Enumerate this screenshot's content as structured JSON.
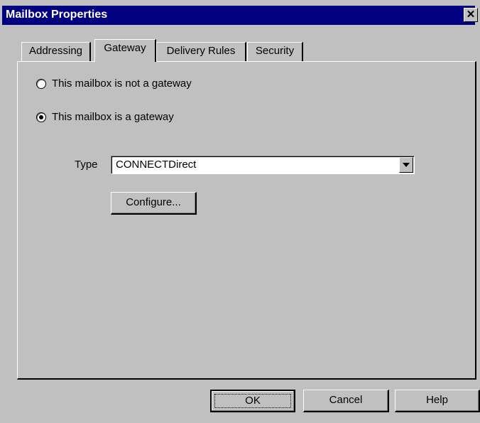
{
  "window": {
    "title": "Mailbox Properties",
    "close_glyph": "✕"
  },
  "tabs": [
    {
      "label": "Addressing",
      "active": false
    },
    {
      "label": "Gateway",
      "active": true
    },
    {
      "label": "Delivery Rules",
      "active": false
    },
    {
      "label": "Security",
      "active": false
    }
  ],
  "gateway": {
    "radio_not_gateway": {
      "label": "This mailbox is not a gateway",
      "selected": false
    },
    "radio_is_gateway": {
      "label": "This mailbox is a gateway",
      "selected": true
    },
    "type_label": "Type",
    "type_value": "CONNECTDirect",
    "configure_label": "Configure..."
  },
  "footer": {
    "ok_label": "OK",
    "cancel_label": "Cancel",
    "help_label": "Help"
  },
  "colors": {
    "titlebar": "#000080",
    "face": "#c0c0c0"
  }
}
